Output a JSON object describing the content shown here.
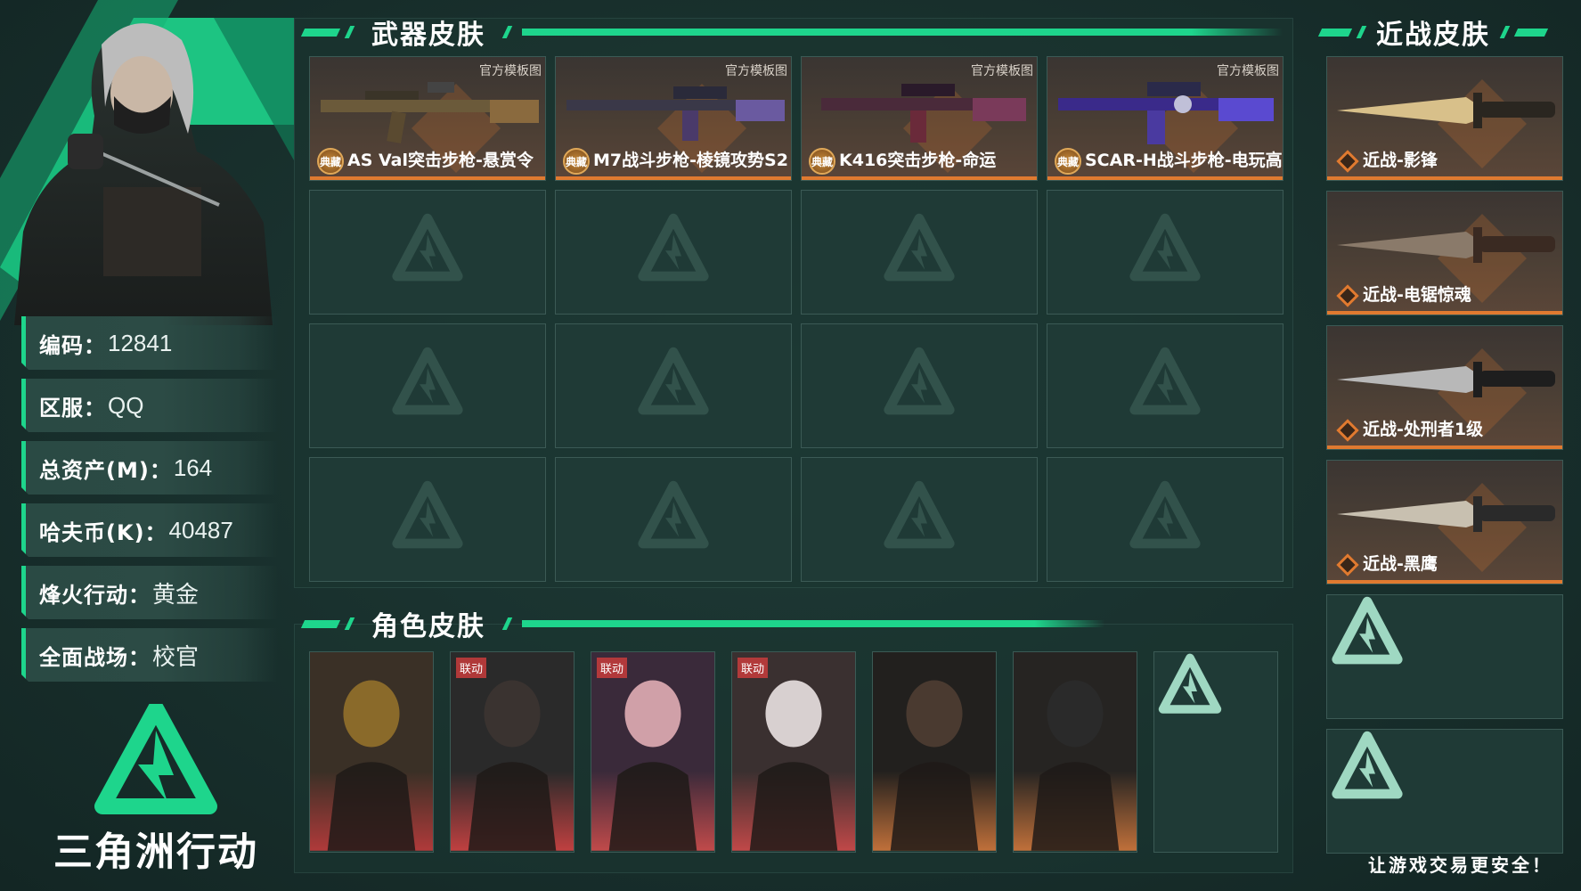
{
  "colors": {
    "accent": "#1ed58c",
    "bg": "#18302d",
    "skin_bar": "#e07a30"
  },
  "profile": {
    "rows": [
      {
        "key": "编码：",
        "value": "12841"
      },
      {
        "key": "区服：",
        "value": "QQ"
      },
      {
        "key": "总资产(M)：",
        "value": "164"
      },
      {
        "key": "哈夫币(K)：",
        "value": "40487"
      },
      {
        "key": "烽火行动：",
        "value": "黄金"
      },
      {
        "key": "全面战场：",
        "value": "校官"
      }
    ]
  },
  "logo_text": "三角洲行动",
  "sections": {
    "weapon": "武器皮肤",
    "melee": "近战皮肤",
    "character": "角色皮肤"
  },
  "weapons": [
    {
      "name": "AS Val突击步枪-悬赏令",
      "tag": "官方模板图",
      "badge": "典藏"
    },
    {
      "name": "M7战斗步枪-棱镜攻势S2",
      "tag": "官方模板图",
      "badge": "典藏"
    },
    {
      "name": "K416突击步枪-命运",
      "tag": "官方模板图",
      "badge": "典藏"
    },
    {
      "name": "SCAR-H战斗步枪-电玩高手",
      "tag": "官方模板图",
      "badge": "典藏"
    }
  ],
  "melee": [
    {
      "name": "近战-影锋"
    },
    {
      "name": "近战-电锯惊魂"
    },
    {
      "name": "近战-处刑者1级"
    },
    {
      "name": "近战-黑鹰"
    }
  ],
  "characters": [
    {
      "label": ""
    },
    {
      "label": "联动"
    },
    {
      "label": "联动"
    },
    {
      "label": "联动"
    },
    {
      "label": ""
    },
    {
      "label": ""
    }
  ],
  "footer": "让游戏交易更安全！"
}
